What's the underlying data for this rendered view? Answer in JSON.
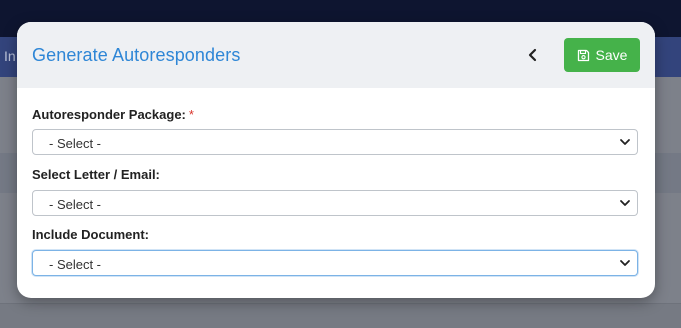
{
  "background": {
    "nav_text": "In"
  },
  "modal": {
    "title": "Generate Autoresponders",
    "back_icon": "chevron-left-icon",
    "save_icon": "floppy-disk-icon",
    "save_label": "Save",
    "colors": {
      "title": "#2e86d6",
      "save_button": "#45b24a",
      "required_marker": "#d9342b"
    },
    "fields": [
      {
        "label": "Autoresponder Package:",
        "required_marker": "*",
        "selected": "- Select -"
      },
      {
        "label": "Select Letter / Email:",
        "selected": "- Select -"
      },
      {
        "label": "Include Document:",
        "selected": "- Select -"
      }
    ]
  }
}
